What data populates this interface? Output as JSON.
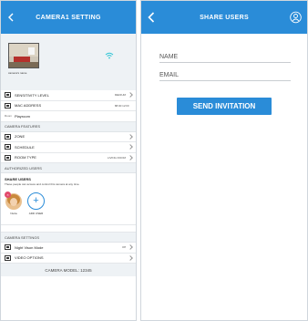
{
  "camera_setting": {
    "title": "CAMERA1 SETTING",
    "camera_name": "camera's name",
    "rows": [
      {
        "label": "SENSITIVITY LEVEL",
        "value": "MEDIUM"
      },
      {
        "label": "MAC ADDRESS",
        "value": "88:00:12:FF"
      },
      {
        "label": "Playroom",
        "value": "",
        "icon_text": "Room"
      }
    ],
    "features_header": "CAMERA FEATURES",
    "features": [
      {
        "label": "ZONE",
        "value": ""
      },
      {
        "label": "SCHEDULE",
        "value": ""
      },
      {
        "label": "ROOM TYPE",
        "value": "LIVING ROOM"
      }
    ],
    "authorized_header": "AUTHORIZED USERS",
    "share": {
      "heading": "SHARE USERS",
      "description": "These people can access and control this camera at any time.",
      "user_name": "Nuria",
      "user_badge": "×",
      "add_label": "ADD USER",
      "add_symbol": "+"
    },
    "settings_header": "CAMERA SETTINGS",
    "settings": [
      {
        "label": "Night Vison Mode",
        "value": "Off"
      },
      {
        "label": "VIDEO OPTIONS",
        "value": ""
      }
    ],
    "footer": "CAMERA MODEL: 12345"
  },
  "share_users": {
    "title": "SHARE USERS",
    "name_placeholder": "NAME",
    "email_placeholder": "EMAIL",
    "send_button": "SEND INVITATION"
  },
  "colors": {
    "accent": "#2a8cd8",
    "section_bg": "#eef2f5",
    "badge": "#e24a6c"
  },
  "icons": [
    "back-chevron-icon",
    "wifi-icon",
    "settings-box-icon",
    "chevron-right-icon",
    "user-profile-icon",
    "plus-icon"
  ]
}
